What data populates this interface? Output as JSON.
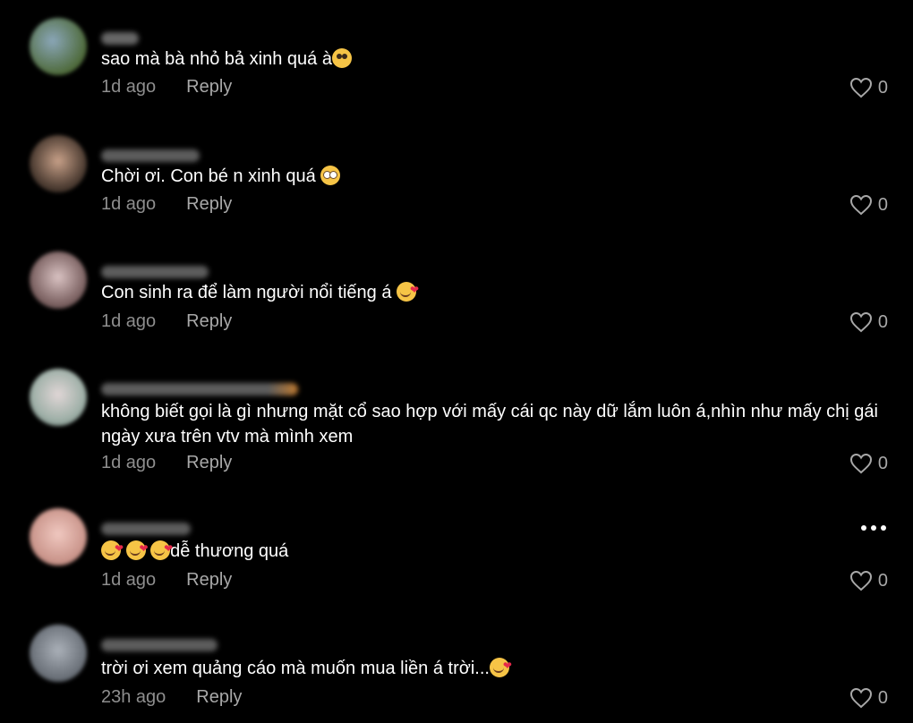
{
  "colors": {
    "background": "#000000",
    "text": "#ffffff",
    "muted": "#8e8e8e"
  },
  "comments": [
    {
      "text": "sao mà bà nhỏ bả xinh quá à",
      "emoji": "shy-face-emoji",
      "time": "1d ago",
      "reply": "Reply",
      "likes": "0"
    },
    {
      "text": "Chời ơi. Con bé n xinh quá ",
      "emoji": "flushed-face-emoji",
      "time": "1d ago",
      "reply": "Reply",
      "likes": "0"
    },
    {
      "text": "Con sinh ra để làm người nổi tiếng á ",
      "emoji": "smiling-hearts-emoji",
      "time": "1d ago",
      "reply": "Reply",
      "likes": "0"
    },
    {
      "text": "không biết gọi là gì nhưng mặt cổ sao hợp với mấy cái qc này dữ lắm luôn á,nhìn như mấy chị gái ngày xưa trên vtv mà mình xem",
      "time": "1d ago",
      "reply": "Reply",
      "likes": "0"
    },
    {
      "text": "dễ thương quá",
      "emoji": "smiling-hearts-emoji",
      "time": "1d ago",
      "reply": "Reply",
      "likes": "0",
      "more": "more-options"
    },
    {
      "text": "trời ơi xem quảng cáo mà muốn mua liền á trời...",
      "emoji": "smiling-hearts-emoji",
      "time": "23h ago",
      "reply": "Reply",
      "likes": "0"
    }
  ]
}
